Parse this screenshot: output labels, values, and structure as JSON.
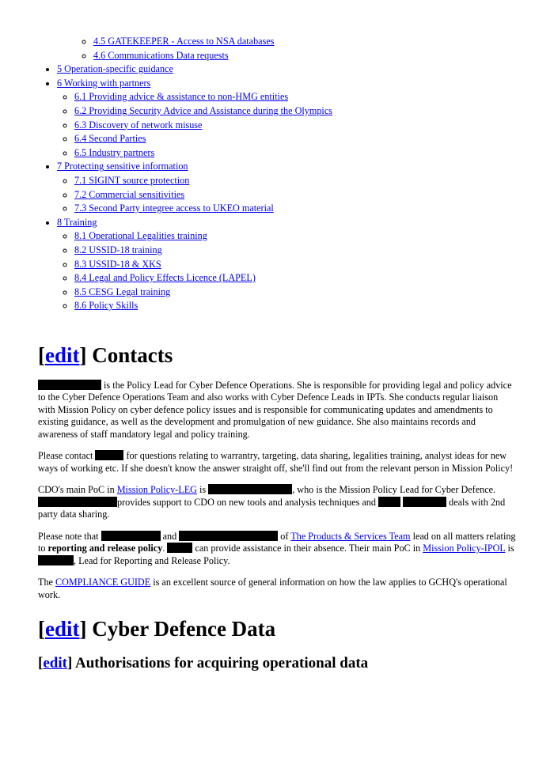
{
  "toc": {
    "orphan_items": [
      "4.5 GATEKEEPER - Access to NSA databases",
      "4.6 Communications Data requests"
    ],
    "sections": [
      {
        "label": "5 Operation-specific guidance",
        "children": []
      },
      {
        "label": "6 Working with partners",
        "children": [
          "6.1 Providing advice & assistance to non-HMG entities",
          "6.2 Providing Security Advice and Assistance during the Olympics",
          "6.3 Discovery of network misuse",
          "6.4 Second Parties",
          "6.5 Industry partners"
        ]
      },
      {
        "label": "7 Protecting sensitive information",
        "children": [
          "7.1 SIGINT source protection",
          "7.2 Commercial sensitivities",
          "7.3 Second Party integree access to UKEO material"
        ]
      },
      {
        "label": "8 Training",
        "children": [
          "8.1 Operational Legalities training",
          "8.2 USSID-18 training",
          "8.3 USSID-18 & XKS",
          "8.4 Legal and Policy Effects Licence (LAPEL)",
          "8.5 CESG Legal training",
          "8.6 Policy Skills"
        ]
      }
    ]
  },
  "edit_label": "edit",
  "contacts": {
    "heading": "Contacts",
    "p1": " is the Policy Lead for Cyber Defence Operations. She is responsible for providing legal and policy advice to the Cyber Defence Operations Team and also works with Cyber Defence Leads in IPTs. She conducts regular liaison with Mission Policy on cyber defence policy issues and is responsible for communicating updates and amendments to existing guidance, as well as the development and promulgation of new guidance. She also maintains records and awareness of staff mandatory legal and policy training.",
    "p2_a": "Please contact ",
    "p2_b": " for questions relating to warrantry, targeting, data sharing, legalities training, analyst ideas for new ways of working etc. If she doesn't know the answer straight off, she'll find out from the relevant person in Mission Policy!",
    "p3_a": "CDO's main PoC in ",
    "p3_link": "Mission Policy-LEG",
    "p3_b": " is ",
    "p3_c": ", who is the Mission Policy Lead for Cyber Defence. ",
    "p3_d": "provides support to CDO on new tools and analysis techniques and ",
    "p3_e": " deals with 2nd party data sharing.",
    "p4_a": "Please note that ",
    "p4_b": " and ",
    "p4_c": " of ",
    "p4_link1": "The Products & Services Team",
    "p4_d": " lead on all matters relating to ",
    "p4_bold": "reporting and release policy",
    "p4_e": ". ",
    "p4_f": " can provide assistance in their absence. Their main PoC in ",
    "p4_link2": "Mission Policy-IPOL",
    "p4_g": " is ",
    "p4_h": ", Lead for Reporting and Release Policy.",
    "p5_a": "The ",
    "p5_link": "COMPLIANCE GUIDE",
    "p5_b": " is an excellent source of general information on how the law applies to GCHQ's operational work."
  },
  "cyber_data": {
    "heading": "Cyber Defence Data",
    "subheading": "Authorisations for acquiring operational data"
  },
  "colors": {
    "link": "#0000ee",
    "redaction": "#000000"
  }
}
